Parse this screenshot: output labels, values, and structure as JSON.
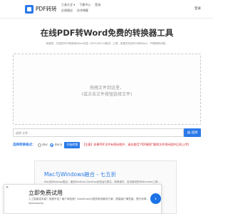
{
  "header": {
    "brand": "PDF转转",
    "nav": [
      [
        "工具大全 ▾",
        "下载中心",
        "登录"
      ],
      [
        "反馈建议",
        "技术博客"
      ]
    ],
    "login": "登录"
  },
  "hero": {
    "title": "在线PDF转Word免费的转换器工具",
    "description": "免费的、在线的PDF转换成Word文档（DOC/DOCX格式）工具，免费的在线PDF转Word，不限转换次数。"
  },
  "dropzone": {
    "line1": "拖拽文件到这里，",
    "line2": "(或点击文件按钮选择文件)"
  },
  "file": {
    "placeholder": "选择 文件...",
    "choose_label": "选择"
  },
  "format": {
    "label": "选择转换格式：",
    "options": [
      "doc",
      "docx"
    ],
    "selected": "docx",
    "start_label": "开始转换",
    "tip": "【注意】如果PDF文件有密码保护，请先使用“PDF解密”解除文件密码保护后再上传】"
  },
  "ad_card": {
    "title": "Mac与Windows融合 - 七五折",
    "description": "Mac用Windows融合，使用Parallels Desktop系统运行原生，简单操作，支持使用所有Windows工具..."
  },
  "popup": {
    "close": "×",
    "title": "立即免费试用",
    "description": "人工智能成本高？回报不佳？客户体验差？SaleSmartly提供有效解决方案，提高客户满意度，提升效率。",
    "source": "Salesmartly"
  },
  "colors": {
    "accent": "#2a79e8",
    "warning": "#d2232a"
  }
}
